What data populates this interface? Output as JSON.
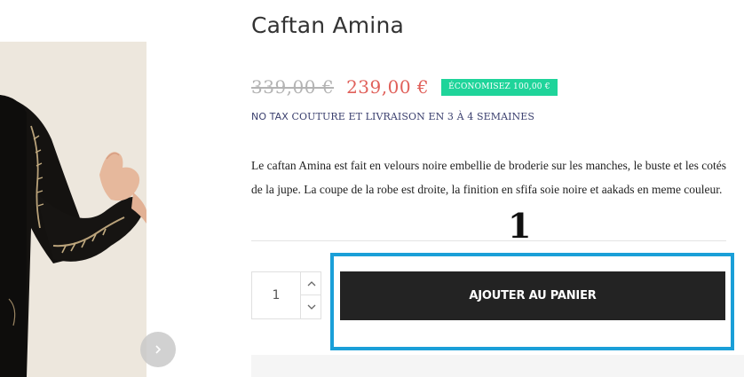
{
  "product": {
    "title": "Caftan Amina",
    "old_price": "339,00 €",
    "new_price": "239,00 €",
    "savings_badge": "ÉCONOMISEZ 100,00 €",
    "tax_label": "NO TAX",
    "delivery_note": "COUTURE ET LIVRAISON EN 3 À 4 SEMAINES",
    "description": "Le caftan Amina est fait en velours noire embellie de broderie sur les manches, le buste et les cotés de la jupe. La coupe de la robe est droite, la finition en sfifa soie noire et aakads en meme couleur."
  },
  "cart": {
    "quantity": "1",
    "add_to_cart_label": "AJOUTER AU PANIER"
  },
  "annotation": {
    "number": "1"
  },
  "colors": {
    "sale_price": "#e0605a",
    "badge": "#1fd49a",
    "highlight": "#1a9fd8",
    "button": "#232323"
  },
  "icons": {
    "gallery_next": "chevron-right-icon",
    "qty_up": "chevron-up-icon",
    "qty_down": "chevron-down-icon"
  }
}
